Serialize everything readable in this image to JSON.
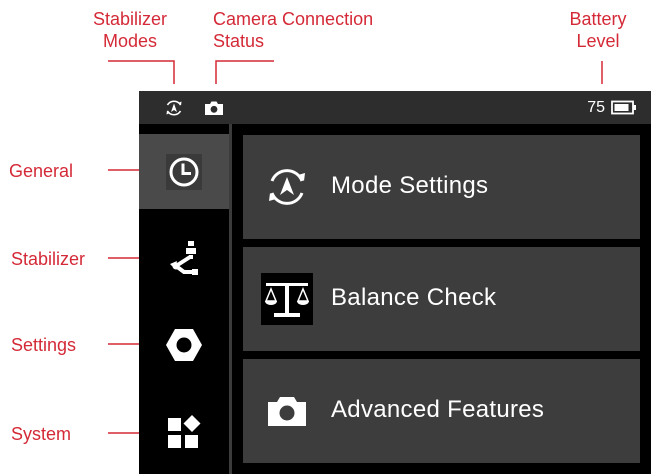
{
  "annotations": {
    "stabilizer_modes": [
      "Stabilizer",
      "Modes"
    ],
    "camera_connection": [
      "Camera Connection",
      "Status"
    ],
    "battery_level": [
      "Battery",
      "Level"
    ],
    "general": "General",
    "stabilizer": "Stabilizer",
    "settings": "Settings",
    "system": "System"
  },
  "status_bar": {
    "battery_value": "75",
    "icons": [
      "stabilizer-mode-icon",
      "camera-icon",
      "battery-icon"
    ]
  },
  "sidebar": {
    "items": [
      {
        "id": "general",
        "icon": "clock-icon",
        "active": true
      },
      {
        "id": "stabilizer",
        "icon": "gimbal-icon",
        "active": false
      },
      {
        "id": "settings",
        "icon": "hexagon-icon",
        "active": false
      },
      {
        "id": "system",
        "icon": "apps-icon",
        "active": false
      }
    ]
  },
  "menu": {
    "items": [
      {
        "label": "Mode Settings",
        "icon": "mode-cycle-icon"
      },
      {
        "label": "Balance Check",
        "icon": "balance-icon"
      },
      {
        "label": "Advanced Features",
        "icon": "camera-icon"
      }
    ]
  },
  "colors": {
    "annotation": "#d42a37",
    "status_bar": "#2d2d2d",
    "active_sidebar": "#4a4a4a",
    "menu_button": "#3d3d3d",
    "screen_background": "#000000"
  }
}
